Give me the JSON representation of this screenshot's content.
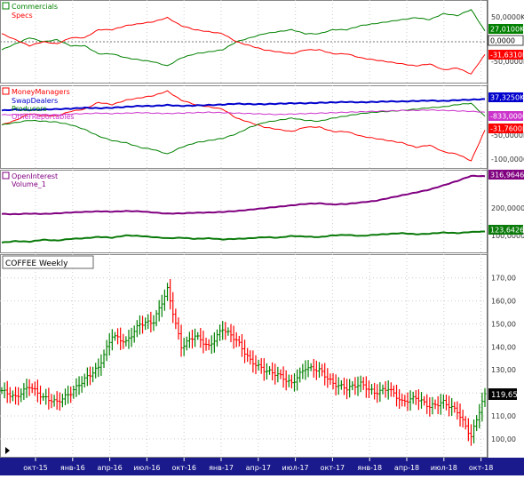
{
  "colors": {
    "green": "#008000",
    "red": "#ff0000",
    "blue": "#0000cc",
    "magenta": "#cc33cc",
    "purple": "#800080",
    "dark_green": "#0a7a0a",
    "axis_bg": "#1a1a8c",
    "grid": "#cccccc"
  },
  "panel1": {
    "legend": [
      "Commercials",
      "Specs"
    ],
    "ticks": [
      "50,0000K",
      "-50,0000K"
    ],
    "last_values": [
      "27,0100K",
      "0,0000",
      "-31,6310K"
    ]
  },
  "panel2": {
    "legend": [
      "MoneyManagers",
      "SwapDealers",
      "Producers",
      "OtherReportables"
    ],
    "ticks": [
      "-50,0000K",
      "-100,0000K"
    ],
    "last_values": [
      "37,3250K",
      "-833,0000",
      "-31,7600K"
    ]
  },
  "panel3": {
    "legend": [
      "OpenInterest",
      "Volume_1"
    ],
    "ticks": [
      "200,0000K",
      "100,0000K"
    ],
    "last_values": [
      "316,9646K",
      "123,6426K"
    ]
  },
  "price_panel": {
    "title": "COFFEE Weekly",
    "last_price": "119,65",
    "ticks": [
      "170,00",
      "160,00",
      "150,00",
      "140,00",
      "130,00",
      "120,00",
      "110,00",
      "100,00"
    ]
  },
  "x_axis": {
    "ticks": [
      "окт-15",
      "янв-16",
      "апр-16",
      "июл-16",
      "окт-16",
      "янв-17",
      "апр-17",
      "июл-17",
      "окт-17",
      "янв-18",
      "апр-18",
      "июл-18",
      "окт-18"
    ]
  },
  "chart_data": {
    "type": "line",
    "title": "COFFEE Weekly",
    "x_range": [
      "2015-09",
      "2018-10"
    ],
    "price_ohlc_keypoints": {
      "x": [
        "2015-09",
        "2015-10",
        "2015-12",
        "2016-01",
        "2016-02",
        "2016-04",
        "2016-05",
        "2016-06",
        "2016-07",
        "2016-08",
        "2016-09",
        "2016-10",
        "2016-11",
        "2016-12",
        "2017-01",
        "2017-02",
        "2017-03",
        "2017-04",
        "2017-05",
        "2017-06",
        "2017-07",
        "2017-08",
        "2017-09",
        "2017-10",
        "2017-11",
        "2017-12",
        "2018-01",
        "2018-02",
        "2018-03",
        "2018-04",
        "2018-05",
        "2018-06",
        "2018-07",
        "2018-08",
        "2018-09",
        "2018-10"
      ],
      "close": [
        121,
        118,
        123,
        118,
        116,
        120,
        126,
        131,
        145,
        142,
        150,
        151,
        165,
        140,
        145,
        140,
        148,
        143,
        134,
        130,
        128,
        124,
        131,
        130,
        124,
        122,
        124,
        120,
        122,
        116,
        118,
        114,
        116,
        112,
        101,
        119.65
      ],
      "ylim": [
        93,
        178
      ]
    },
    "series": [
      {
        "name": "Commercials",
        "panel": 1,
        "values_k": [
          -20,
          -5,
          10,
          0,
          5,
          -10,
          -10,
          -30,
          -30,
          -40,
          -45,
          -50,
          -60,
          -40,
          -30,
          -25,
          -20,
          0,
          10,
          20,
          25,
          30,
          20,
          20,
          30,
          30,
          40,
          45,
          50,
          55,
          60,
          55,
          70,
          65,
          80,
          27.01
        ]
      },
      {
        "name": "Specs",
        "panel": 1,
        "values_k": [
          20,
          5,
          -10,
          0,
          -5,
          10,
          10,
          30,
          30,
          40,
          45,
          50,
          60,
          40,
          30,
          25,
          20,
          0,
          -10,
          -20,
          -25,
          -30,
          -20,
          -20,
          -30,
          -30,
          -40,
          -45,
          -50,
          -55,
          -60,
          -55,
          -70,
          -65,
          -80,
          -31.631
        ]
      },
      {
        "name": "MoneyManagers",
        "panel": 2,
        "values_k": [
          -20,
          -10,
          5,
          0,
          0,
          10,
          15,
          30,
          25,
          35,
          40,
          45,
          55,
          35,
          25,
          20,
          15,
          -5,
          -15,
          -25,
          -30,
          -35,
          -25,
          -25,
          -35,
          -35,
          -45,
          -50,
          -55,
          -60,
          -70,
          -65,
          -80,
          -85,
          -100,
          -31.76
        ]
      },
      {
        "name": "SwapDealers",
        "panel": 2,
        "values_k": [
          12,
          14,
          13,
          14,
          15,
          16,
          18,
          17,
          18,
          20,
          22,
          22,
          24,
          22,
          23,
          24,
          25,
          27,
          26,
          26,
          27,
          28,
          28,
          29,
          30,
          31,
          30,
          31,
          32,
          32,
          33,
          34,
          33,
          35,
          36,
          37.325
        ]
      },
      {
        "name": "Producers",
        "panel": 2,
        "values_k": [
          -20,
          -15,
          -10,
          -12,
          -14,
          -20,
          -30,
          -45,
          -55,
          -60,
          -70,
          -75,
          -85,
          -70,
          -60,
          -55,
          -50,
          -40,
          -25,
          -15,
          -10,
          -5,
          -10,
          -12,
          -5,
          0,
          5,
          8,
          10,
          12,
          15,
          18,
          20,
          25,
          28,
          -0.833
        ]
      },
      {
        "name": "OtherReportables",
        "panel": 2,
        "values_k": [
          2,
          3,
          4,
          3,
          2,
          4,
          5,
          6,
          5,
          6,
          7,
          6,
          5,
          6,
          7,
          8,
          7,
          6,
          5,
          4,
          3,
          4,
          5,
          6,
          7,
          8,
          9,
          10,
          11,
          12,
          12,
          13,
          12,
          11,
          10,
          8
        ]
      },
      {
        "name": "OpenInterest",
        "panel": 3,
        "values_k": [
          185,
          184,
          186,
          185,
          187,
          190,
          192,
          194,
          193,
          195,
          194,
          190,
          186,
          187,
          189,
          190,
          192,
          195,
          200,
          205,
          210,
          215,
          220,
          222,
          218,
          220,
          225,
          230,
          240,
          250,
          260,
          270,
          285,
          300,
          318,
          316.9646
        ]
      },
      {
        "name": "Volume_1",
        "panel": 3,
        "values_k": [
          85,
          90,
          88,
          95,
          92,
          98,
          100,
          105,
          102,
          110,
          108,
          104,
          100,
          102,
          98,
          100,
          96,
          98,
          100,
          104,
          102,
          108,
          106,
          104,
          110,
          112,
          108,
          112,
          115,
          118,
          114,
          116,
          120,
          118,
          122,
          123.6426
        ]
      }
    ]
  }
}
